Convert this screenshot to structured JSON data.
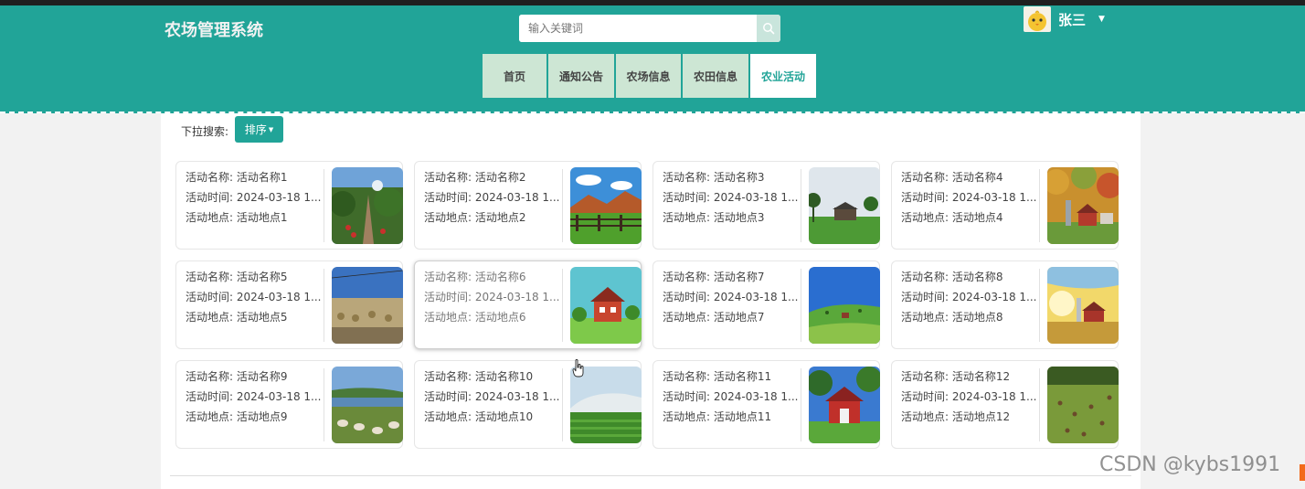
{
  "header": {
    "title": "农场管理系统",
    "search": {
      "placeholder": "输入关键词"
    },
    "user": {
      "name": "张三"
    }
  },
  "nav": {
    "items": [
      {
        "label": "首页",
        "active": false
      },
      {
        "label": "通知公告",
        "active": false
      },
      {
        "label": "农场信息",
        "active": false
      },
      {
        "label": "农田信息",
        "active": false
      },
      {
        "label": "农业活动",
        "active": true
      }
    ]
  },
  "filter": {
    "label": "下拉搜索:",
    "sort_label": "排序"
  },
  "activities": [
    {
      "name": "活动名称: 活动名称1",
      "time": "活动时间: 2024-03-18 1...",
      "location": "活动地点: 活动地点1",
      "image": "farm-path-photo"
    },
    {
      "name": "活动名称: 活动名称2",
      "time": "活动时间: 2024-03-18 1...",
      "location": "活动地点: 活动地点2",
      "image": "fence-meadow-photo"
    },
    {
      "name": "活动名称: 活动名称3",
      "time": "活动时间: 2024-03-18 1...",
      "location": "活动地点: 活动地点3",
      "image": "barn-field-photo"
    },
    {
      "name": "活动名称: 活动名称4",
      "time": "活动时间: 2024-03-18 1...",
      "location": "活动地点: 活动地点4",
      "image": "autumn-farm-photo"
    },
    {
      "name": "活动名称: 活动名称5",
      "time": "活动时间: 2024-03-18 1...",
      "location": "活动地点: 活动地点5",
      "image": "hay-field-photo"
    },
    {
      "name": "活动名称: 活动名称6",
      "time": "活动时间: 2024-03-18 1...",
      "location": "活动地点: 活动地点6",
      "image": "red-house-photo"
    },
    {
      "name": "活动名称: 活动名称7",
      "time": "活动时间: 2024-03-18 1...",
      "location": "活动地点: 活动地点7",
      "image": "green-hills-photo"
    },
    {
      "name": "活动名称: 活动名称8",
      "time": "活动时间: 2024-03-18 1...",
      "location": "活动地点: 活动地点8",
      "image": "sunset-barn-photo"
    },
    {
      "name": "活动名称: 活动名称9",
      "time": "活动时间: 2024-03-18 1...",
      "location": "活动地点: 活动地点9",
      "image": "sheep-river-photo"
    },
    {
      "name": "活动名称: 活动名称10",
      "time": "活动时间: 2024-03-18 1...",
      "location": "活动地点: 活动地点10",
      "image": "greenhouse-photo"
    },
    {
      "name": "活动名称: 活动名称11",
      "time": "活动时间: 2024-03-18 1...",
      "location": "活动地点: 活动地点11",
      "image": "red-barn-photo"
    },
    {
      "name": "活动名称: 活动名称12",
      "time": "活动时间: 2024-03-18 1...",
      "location": "活动地点: 活动地点12",
      "image": "chickens-pasture-photo"
    }
  ],
  "watermark": "CSDN @kybs1991",
  "colors": {
    "primary": "#21a498",
    "nav_bg": "#cde6d4"
  },
  "icons": {
    "search": "search-icon",
    "dropdown": "caret-down-icon",
    "user": "chick-avatar-icon"
  }
}
